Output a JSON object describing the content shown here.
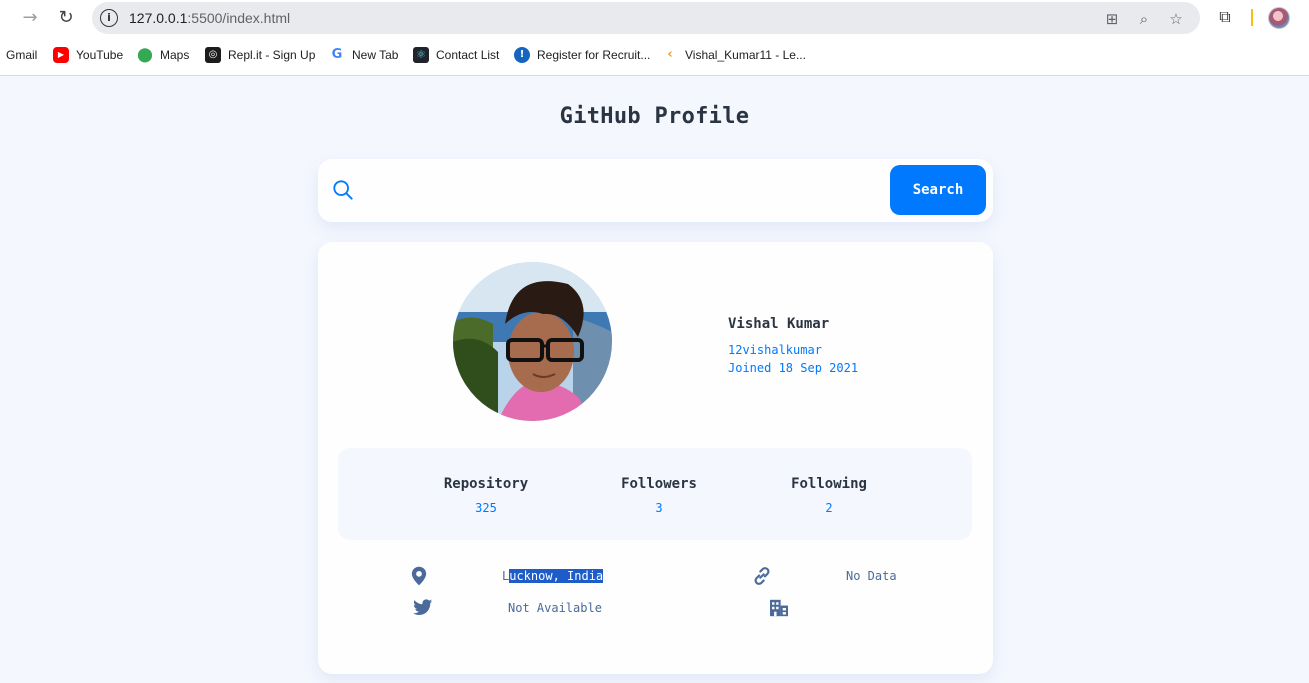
{
  "browser": {
    "url_host": "127.0.0.1",
    "url_rest": ":5500/index.html",
    "bookmarks": [
      {
        "label": "Gmail",
        "icon": "gmail-icon"
      },
      {
        "label": "YouTube",
        "icon": "youtube-icon"
      },
      {
        "label": "Maps",
        "icon": "maps-icon"
      },
      {
        "label": "Repl.it - Sign Up",
        "icon": "replit-icon"
      },
      {
        "label": "New Tab",
        "icon": "google-icon"
      },
      {
        "label": "Contact List",
        "icon": "react-icon"
      },
      {
        "label": "Register for Recruit...",
        "icon": "register-icon"
      },
      {
        "label": "Vishal_Kumar11 - Le...",
        "icon": "leetcode-icon"
      }
    ]
  },
  "app": {
    "title": "GitHub Profile"
  },
  "search": {
    "placeholder": "",
    "value": "",
    "button_label": "Search"
  },
  "profile": {
    "name": "Vishal Kumar",
    "login": "12vishalkumar",
    "joined": "Joined 18 Sep 2021",
    "stats": [
      {
        "label": "Repository",
        "value": "325"
      },
      {
        "label": "Followers",
        "value": "3"
      },
      {
        "label": "Following",
        "value": "2"
      }
    ],
    "location_first": "L",
    "location_rest": "ucknow, India",
    "blog": "No Data",
    "twitter": "Not Available",
    "company": ""
  },
  "colors": {
    "accent": "#0079ff",
    "background": "#f4f7fe",
    "heading": "#2b3442",
    "muted": "#4b6a9b"
  }
}
